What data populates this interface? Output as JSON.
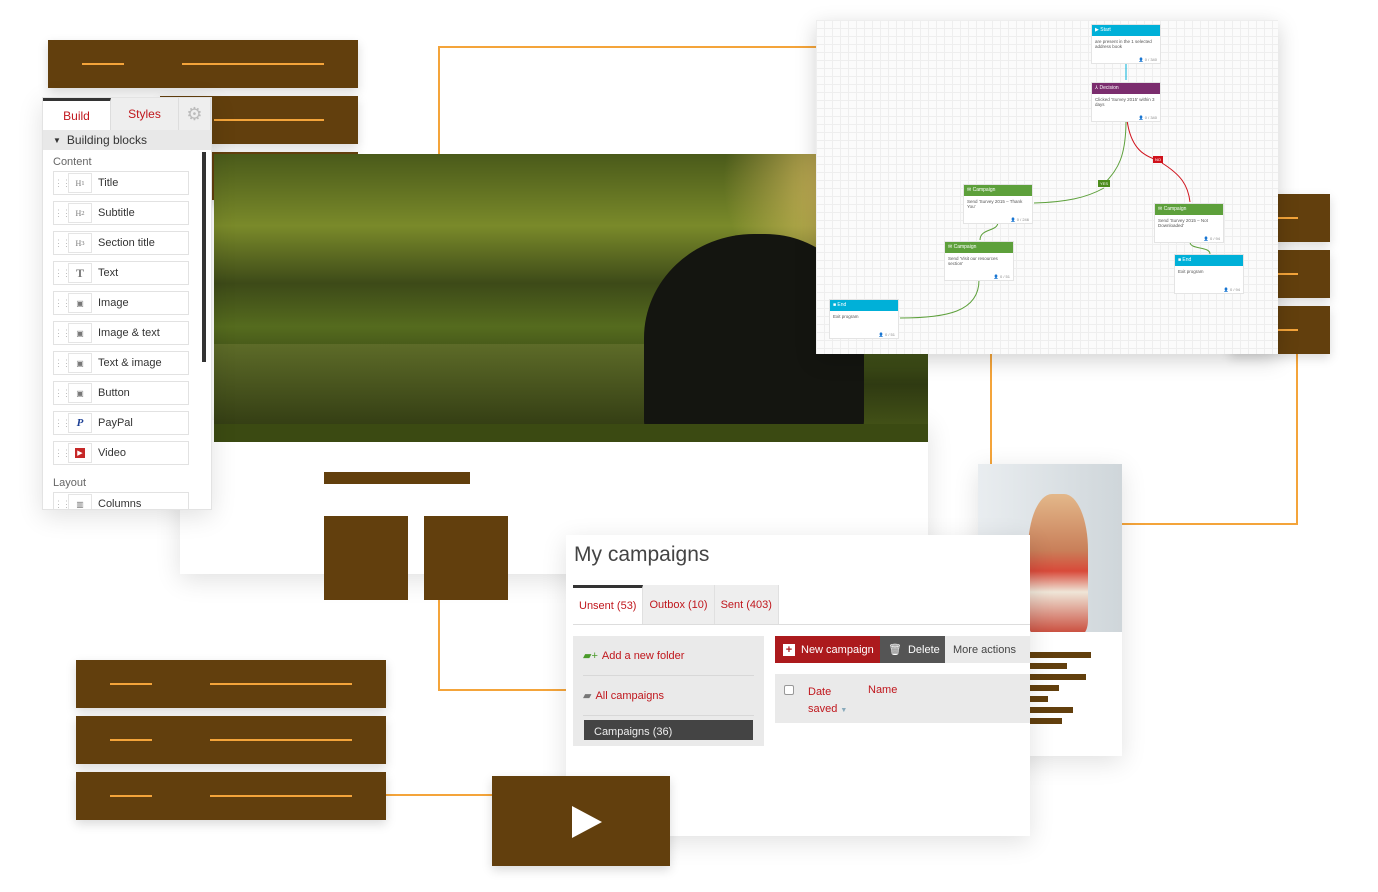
{
  "builder": {
    "tabs": [
      {
        "label": "Build",
        "active": true
      },
      {
        "label": "Styles",
        "active": false
      }
    ],
    "settings_icon": "gear-icon",
    "section_header": "Building blocks",
    "content_label": "Content",
    "content_items": [
      {
        "label": "Title",
        "icon": "H1"
      },
      {
        "label": "Subtitle",
        "icon": "H2"
      },
      {
        "label": "Section title",
        "icon": "H3"
      },
      {
        "label": "Text",
        "icon": "T"
      },
      {
        "label": "Image",
        "icon": "image-icon"
      },
      {
        "label": "Image & text",
        "icon": "image-text-icon"
      },
      {
        "label": "Text & image",
        "icon": "text-image-icon"
      },
      {
        "label": "Button",
        "icon": "button-icon"
      },
      {
        "label": "PayPal",
        "icon": "paypal-icon"
      },
      {
        "label": "Video",
        "icon": "video-icon"
      }
    ],
    "layout_label": "Layout",
    "layout_items": [
      {
        "label": "Columns",
        "icon": "columns-icon"
      }
    ]
  },
  "campaigns": {
    "title": "My campaigns",
    "tabs": [
      {
        "label": "Unsent (53)",
        "active": true
      },
      {
        "label": "Outbox (10)",
        "active": false
      },
      {
        "label": "Sent (403)",
        "active": false
      }
    ],
    "sidebar": {
      "add_folder": "Add a new folder",
      "all": "All campaigns",
      "folder": "Campaigns (36)"
    },
    "buttons": {
      "new": "New campaign",
      "delete": "Delete",
      "more": "More actions"
    },
    "columns": {
      "date": "Date",
      "date2": "saved",
      "name": "Name"
    }
  },
  "workflow": {
    "nodes": [
      {
        "type": "Start",
        "body": "are present in the 1 selected address book",
        "count": "0 / 340",
        "color": "#00b0d8"
      },
      {
        "type": "Decision",
        "body": "Clicked 'Survey 2015' within 3 days",
        "count": "0 / 340",
        "color": "#7b2d6e"
      },
      {
        "type": "Campaign",
        "body": "Send 'Survey 2015 – Thank You'",
        "count": "0 / 246",
        "color": "#5da03b"
      },
      {
        "type": "Campaign",
        "body": "Send 'Visit our resources section'",
        "count": "0 / 51",
        "color": "#5da03b"
      },
      {
        "type": "End",
        "body": "Exit program",
        "count": "0 / 51",
        "color": "#00b0d8"
      },
      {
        "type": "Campaign",
        "body": "Send 'Survey 2015 – Not Downloaded'",
        "count": "0 / 94",
        "color": "#5da03b"
      },
      {
        "type": "End",
        "body": "Exit program",
        "count": "0 / 94",
        "color": "#00b0d8"
      }
    ],
    "yes_label": "YES",
    "no_label": "NO"
  },
  "colors": {
    "brown": "#623f0d",
    "accent_orange": "#f4a43a",
    "brand_red": "#c0171d",
    "yes": "#4c8c1c",
    "no": "#d0111b"
  }
}
